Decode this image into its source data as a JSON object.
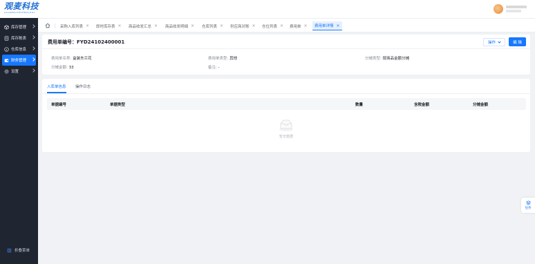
{
  "brand": {
    "name": "观麦科技",
    "sub": "GUANMAITECHNOLOGY",
    "color": "#1f6fd4"
  },
  "sidebar": {
    "items": [
      {
        "label": "库存管理",
        "icon": "cube-icon"
      },
      {
        "label": "库存账表",
        "icon": "ledger-icon"
      },
      {
        "label": "仓库信息",
        "icon": "info-icon"
      },
      {
        "label": "财务管理",
        "icon": "wallet-icon",
        "active": true
      },
      {
        "label": "设置",
        "icon": "gear-icon"
      }
    ],
    "collapse_label": "折叠菜单"
  },
  "tabs": [
    {
      "label": "采购入库列表"
    },
    {
      "label": "即时库存表"
    },
    {
      "label": "商品收发汇总"
    },
    {
      "label": "商品收发明细"
    },
    {
      "label": "仓库列表"
    },
    {
      "label": "供应商对账"
    },
    {
      "label": "仓位列表"
    },
    {
      "label": "费用单"
    },
    {
      "label": "费用单详情",
      "active": true
    }
  ],
  "detail": {
    "title": "费用单编号：FYD24102400001",
    "operate_label": "操作",
    "edit_label": "编 辑",
    "fields": {
      "name_label": "费用单名称:",
      "name_value": "盒装东兰花",
      "type_label": "费用单类型:",
      "type_value": "其他",
      "alloc_type_label": "分摊类型:",
      "alloc_type_value": "按商品金额分摊",
      "amount_label": "分摊金额:",
      "amount_value": "33",
      "note_label": "备注:",
      "note_value": "-"
    }
  },
  "subtabs": {
    "inbound": "入库单信息",
    "log": "操作日志"
  },
  "table": {
    "headers": [
      "单据编号",
      "单据类型",
      "数量",
      "含税金额",
      "分摊金额"
    ],
    "empty_text": "暂无数据"
  },
  "float": {
    "label": "任务"
  },
  "colors": {
    "accent": "#1677ff",
    "sidebar_bg": "#1f2531"
  }
}
